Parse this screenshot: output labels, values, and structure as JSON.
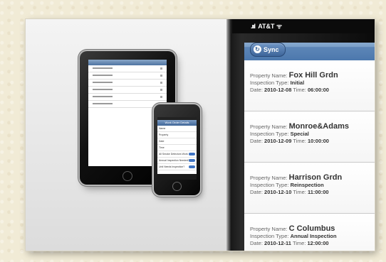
{
  "status": {
    "carrier": "AT&T"
  },
  "toolbar": {
    "sync_label": "Sync"
  },
  "labels": {
    "property": "Property Name:",
    "inspection": "Inspection Type:",
    "date": "Date:",
    "time": "Time:"
  },
  "iphone": {
    "nav_title": "Work Order Details",
    "rows": [
      "Name",
      "Property",
      "Date",
      "Time",
      "All Smoke Detectors Work",
      "Annual Inspection Needed?",
      "Unit Needs Inspection?"
    ]
  },
  "inspections": [
    {
      "property": "Fox Hill Grdn",
      "type": "Initial",
      "date": "2010-12-08",
      "time": "06:00:00"
    },
    {
      "property": "Monroe&Adams",
      "type": "Special",
      "date": "2010-12-09",
      "time": "10:00:00"
    },
    {
      "property": "Harrison Grdn",
      "type": "Reinspection",
      "date": "2010-12-10",
      "time": "11:00:00"
    },
    {
      "property": "C Columbus",
      "type": "Annual Inspection",
      "date": "2010-12-11",
      "time": "12:00:00"
    }
  ]
}
